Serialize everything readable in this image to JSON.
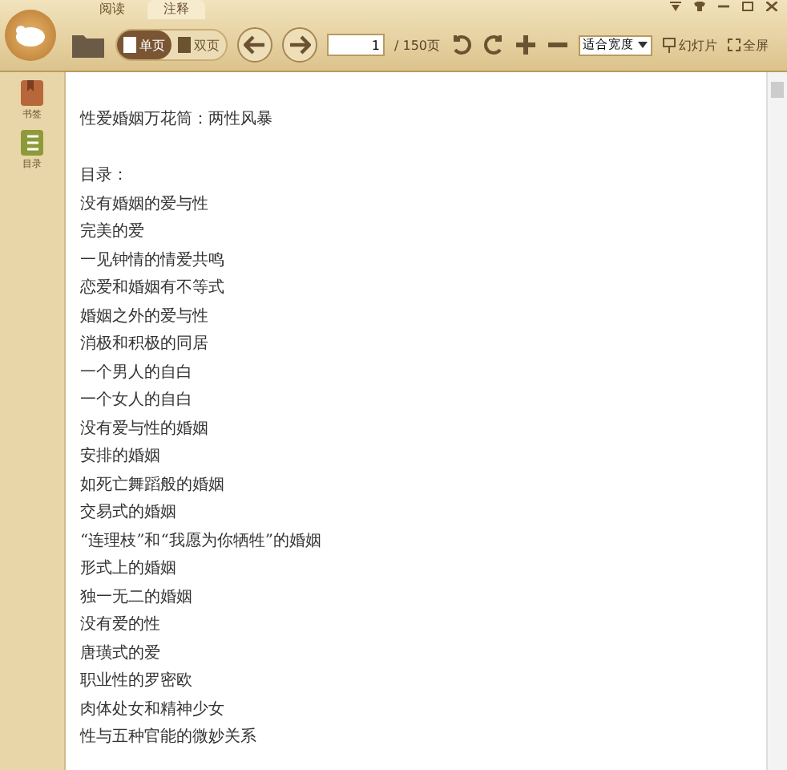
{
  "tabs": [
    {
      "label": "阅读",
      "selected": false
    },
    {
      "label": "注释",
      "selected": true
    }
  ],
  "toolbar": {
    "view_modes": [
      {
        "label": "单页",
        "selected": true
      },
      {
        "label": "双页",
        "selected": false
      }
    ],
    "page_input": "1",
    "page_total": "/ 150页",
    "zoom_select": "适合宽度",
    "slideshow": "幻灯片",
    "fullscreen": "全屏"
  },
  "sidebar": {
    "items": [
      {
        "label": "书签",
        "kind": "bookmark"
      },
      {
        "label": "目录",
        "kind": "toc"
      }
    ]
  },
  "document": {
    "title": "性爱婚姻万花筒：两性风暴",
    "toc_heading": "目录：",
    "lines": [
      "没有婚姻的爱与性",
      "完美的爱",
      "一见钟情的情爱共鸣",
      "恋爱和婚姻有不等式",
      "婚姻之外的爱与性",
      "消极和积极的同居",
      "一个男人的自白",
      "一个女人的自白",
      "没有爱与性的婚姻",
      "安排的婚姻",
      "如死亡舞蹈般的婚姻",
      "交易式的婚姻",
      "“连理枝”和“我愿为你牺牲”的婚姻",
      "形式上的婚姻",
      "独一无二的婚姻",
      "没有爱的性",
      "唐璜式的爱",
      "职业性的罗密欧",
      "肉体处女和精神少女",
      "性与五种官能的微妙关系"
    ]
  }
}
